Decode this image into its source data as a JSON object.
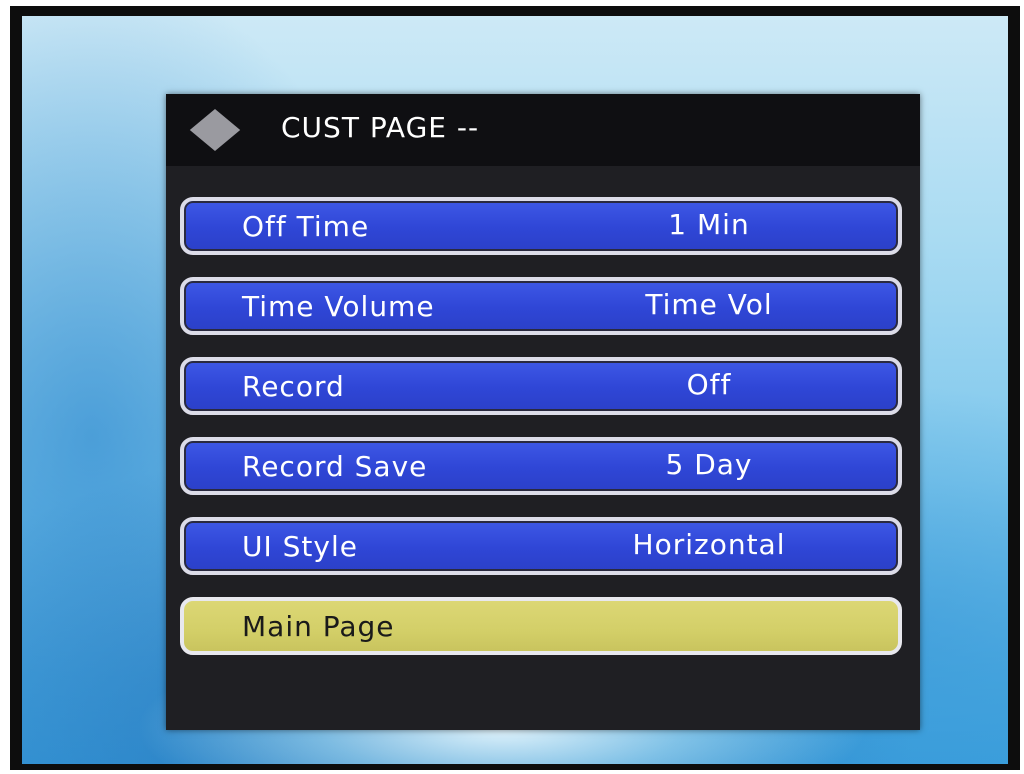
{
  "menu": {
    "title": "CUST PAGE --",
    "items": [
      {
        "label": "Off Time",
        "value": "1 Min"
      },
      {
        "label": "Time Volume",
        "value": "Time Vol"
      },
      {
        "label": "Record",
        "value": "Off"
      },
      {
        "label": "Record Save",
        "value": "5 Day"
      },
      {
        "label": "UI Style",
        "value": "Horizontal"
      },
      {
        "label": "Main Page",
        "value": ""
      }
    ],
    "selected_item": "Main Page"
  },
  "colors": {
    "item_fill": "#3148d8",
    "item_border": "#dcdce8",
    "selected_fill": "#d6d26a",
    "panel": "#1f1f23",
    "header": "#0f0f12",
    "icon": "#9a9aa0"
  },
  "icons": {
    "header_icon": "diamond-icon"
  }
}
